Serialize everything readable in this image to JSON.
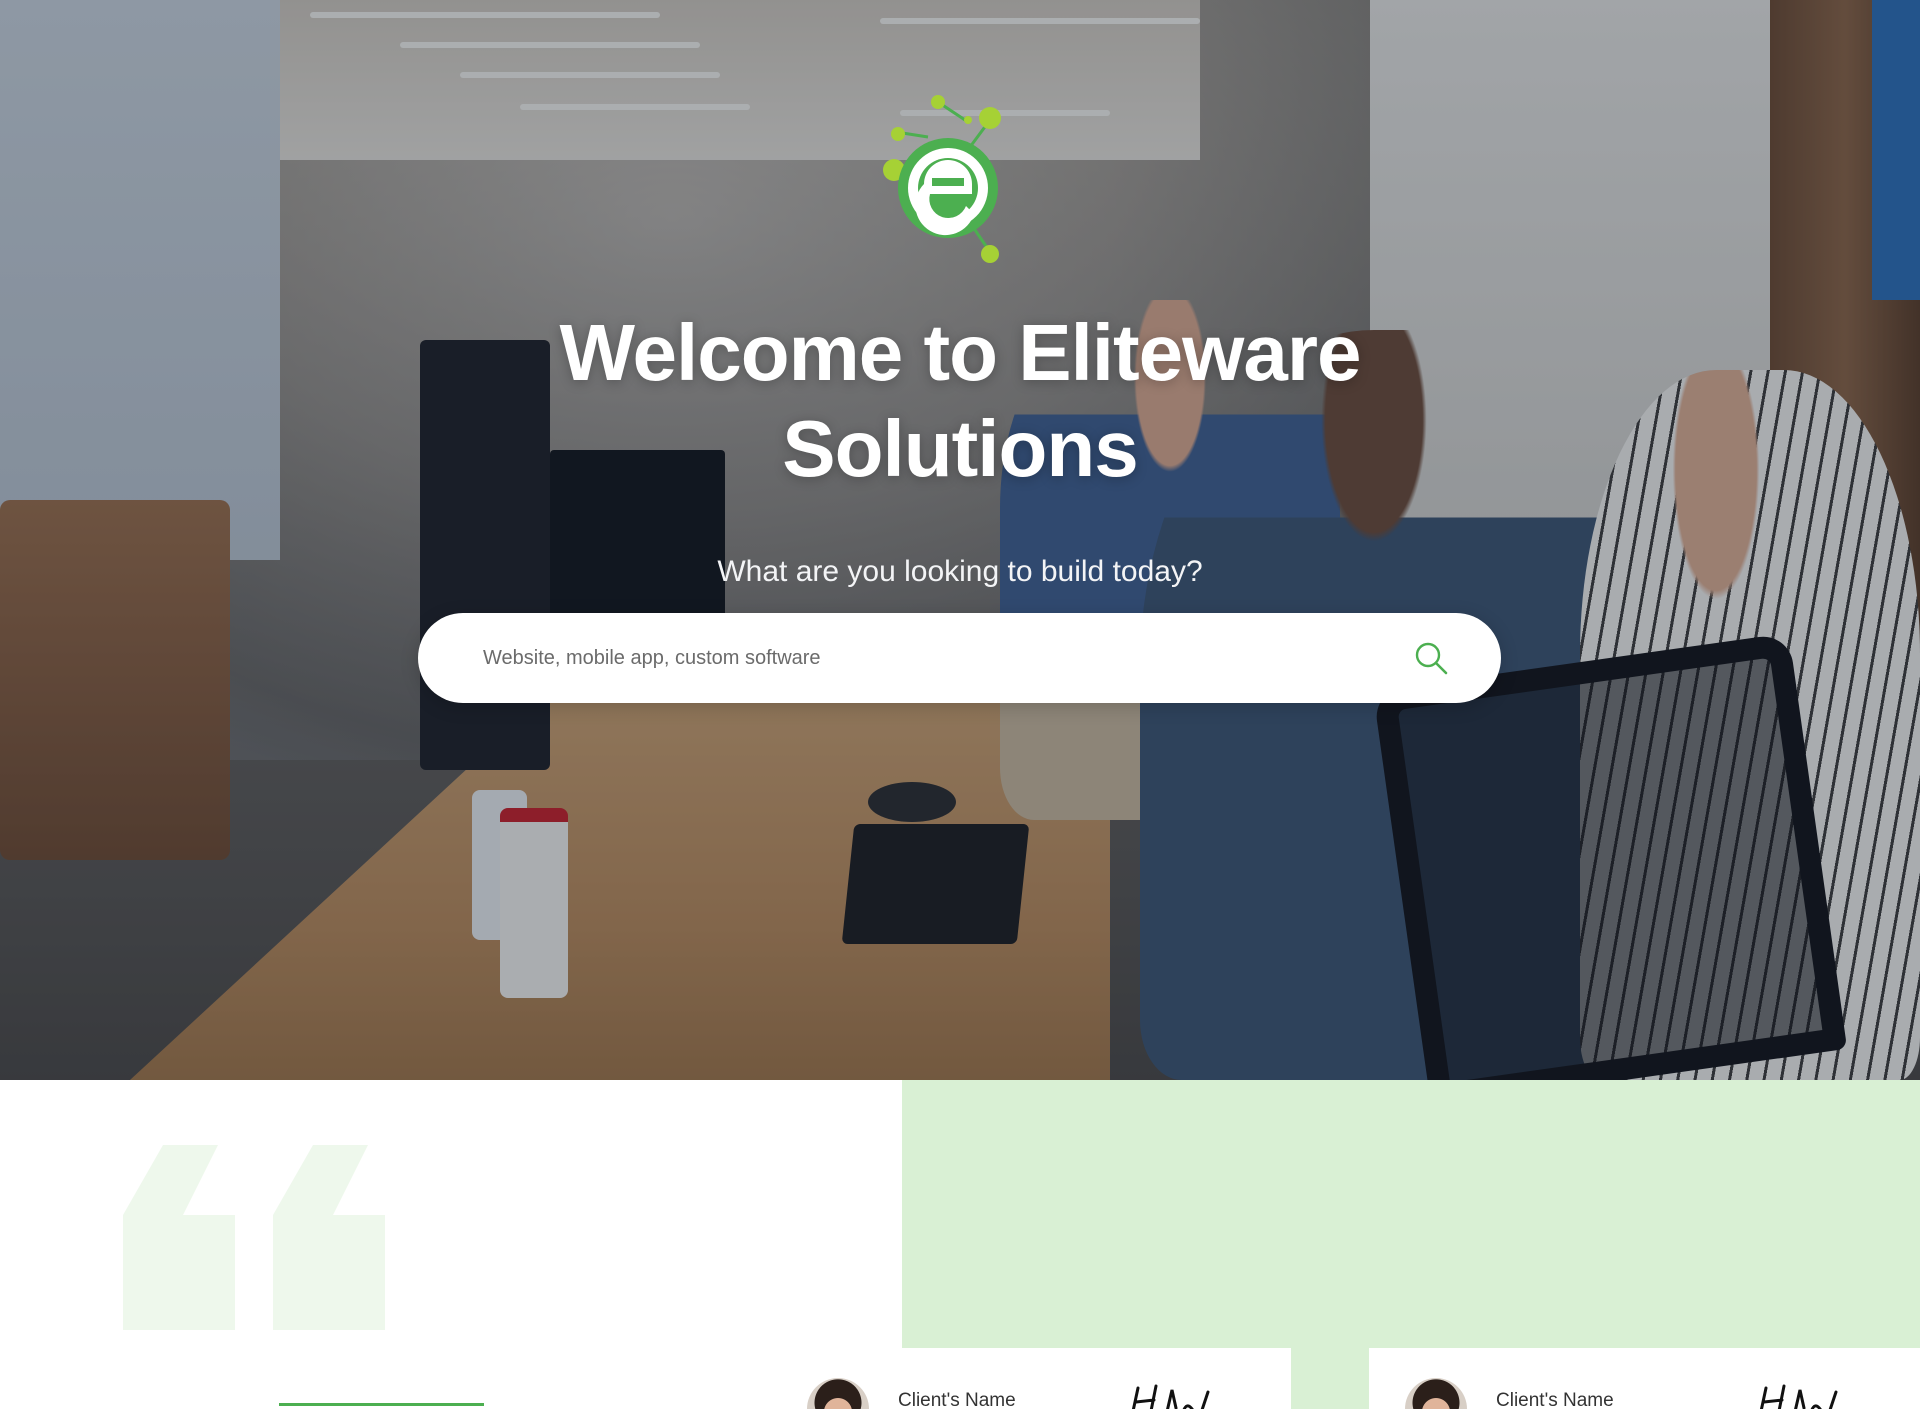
{
  "hero": {
    "title": "Welcome to Eliteware Solutions",
    "subtitle": "What are you looking to build today?",
    "search": {
      "placeholder": "Website, mobile app, custom software",
      "value": ""
    }
  },
  "testimonials": {
    "cards": [
      {
        "client_name": "Client's Name"
      },
      {
        "client_name": "Client's Name"
      }
    ]
  },
  "icons": {
    "logo": "eliteware-logo",
    "search": "search-icon",
    "quote": "quote-icon",
    "avatar": "avatar",
    "signature": "signature-image"
  },
  "colors": {
    "brand_green": "#4caf50",
    "logo_lime": "#a6d135",
    "pale_green": "#d9f0d4",
    "white": "#ffffff"
  }
}
